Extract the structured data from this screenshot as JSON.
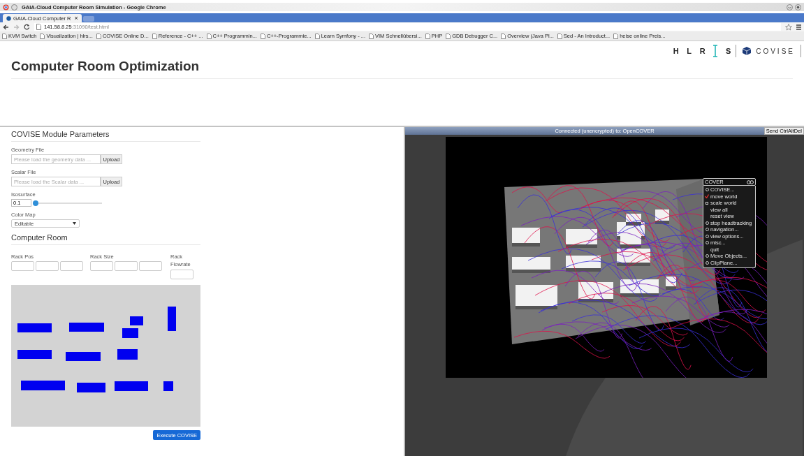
{
  "browser": {
    "window_title": "GAIA-Cloud Computer Room Simulation - Google Chrome",
    "tabs": [
      {
        "label": "GAIA-Cloud Computer R",
        "close": "×",
        "selected": true
      }
    ],
    "url_host": "141.58.8.25",
    "url_rest": ":31090/test.html",
    "bookmarks": [
      "KVM Switch",
      "Visualization | hlrs...",
      "COVISE Online D...",
      "Reference - C++ ...",
      "C++ Programmin...",
      "C++-Programmie...",
      "Learn Symfony - ...",
      "VIM Schnellübersi...",
      "PHP",
      "GDB Debugger C...",
      "Overview (Java Pl...",
      "Sed - An Introduct...",
      "heise online Preis..."
    ]
  },
  "logo": {
    "letters": [
      "H",
      "L",
      "R",
      "S"
    ],
    "product": "COVISE"
  },
  "page_title": "Computer Room Optimization",
  "module_parameters": {
    "heading": "COVISE Module Parameters",
    "geometry_file": {
      "label": "Geometry File",
      "placeholder": "Please load the geometry data ...",
      "button": "Upload"
    },
    "scalar_file": {
      "label": "Scalar File",
      "placeholder": "Please load the Scalar data ...",
      "button": "Upload"
    },
    "isosurface": {
      "label": "Isosurface",
      "value": "0.1",
      "level": 0.03
    },
    "color_map": {
      "label": "Color Map",
      "value": "Editable"
    }
  },
  "computer_room": {
    "heading": "Computer Room",
    "rack_pos_label": "Rack Pos",
    "rack_size_label": "Rack Size",
    "rack_flowrate_label": "Rack Flowrate",
    "button": "Execute COVISE"
  },
  "viewer": {
    "status": "Connected (unencrypted) to: OpenCOVER",
    "button": "Send CtrlAltDel",
    "menu": {
      "title": "COVER",
      "items": [
        {
          "label": "COVISE...",
          "kind": "submenu"
        },
        {
          "label": "move world",
          "kind": "checkbox",
          "checked": true
        },
        {
          "label": "scale world",
          "kind": "checkbox",
          "checked": false
        },
        {
          "label": "view all",
          "kind": "action"
        },
        {
          "label": "reset view",
          "kind": "action"
        },
        {
          "label": "stop headtracking",
          "kind": "submenu"
        },
        {
          "label": "navigation...",
          "kind": "submenu"
        },
        {
          "label": "view options...",
          "kind": "submenu"
        },
        {
          "label": "misc...",
          "kind": "submenu"
        },
        {
          "label": "quit",
          "kind": "action"
        },
        {
          "label": "Move Objects...",
          "kind": "submenu"
        },
        {
          "label": "ClipPlane...",
          "kind": "submenu"
        }
      ]
    }
  }
}
